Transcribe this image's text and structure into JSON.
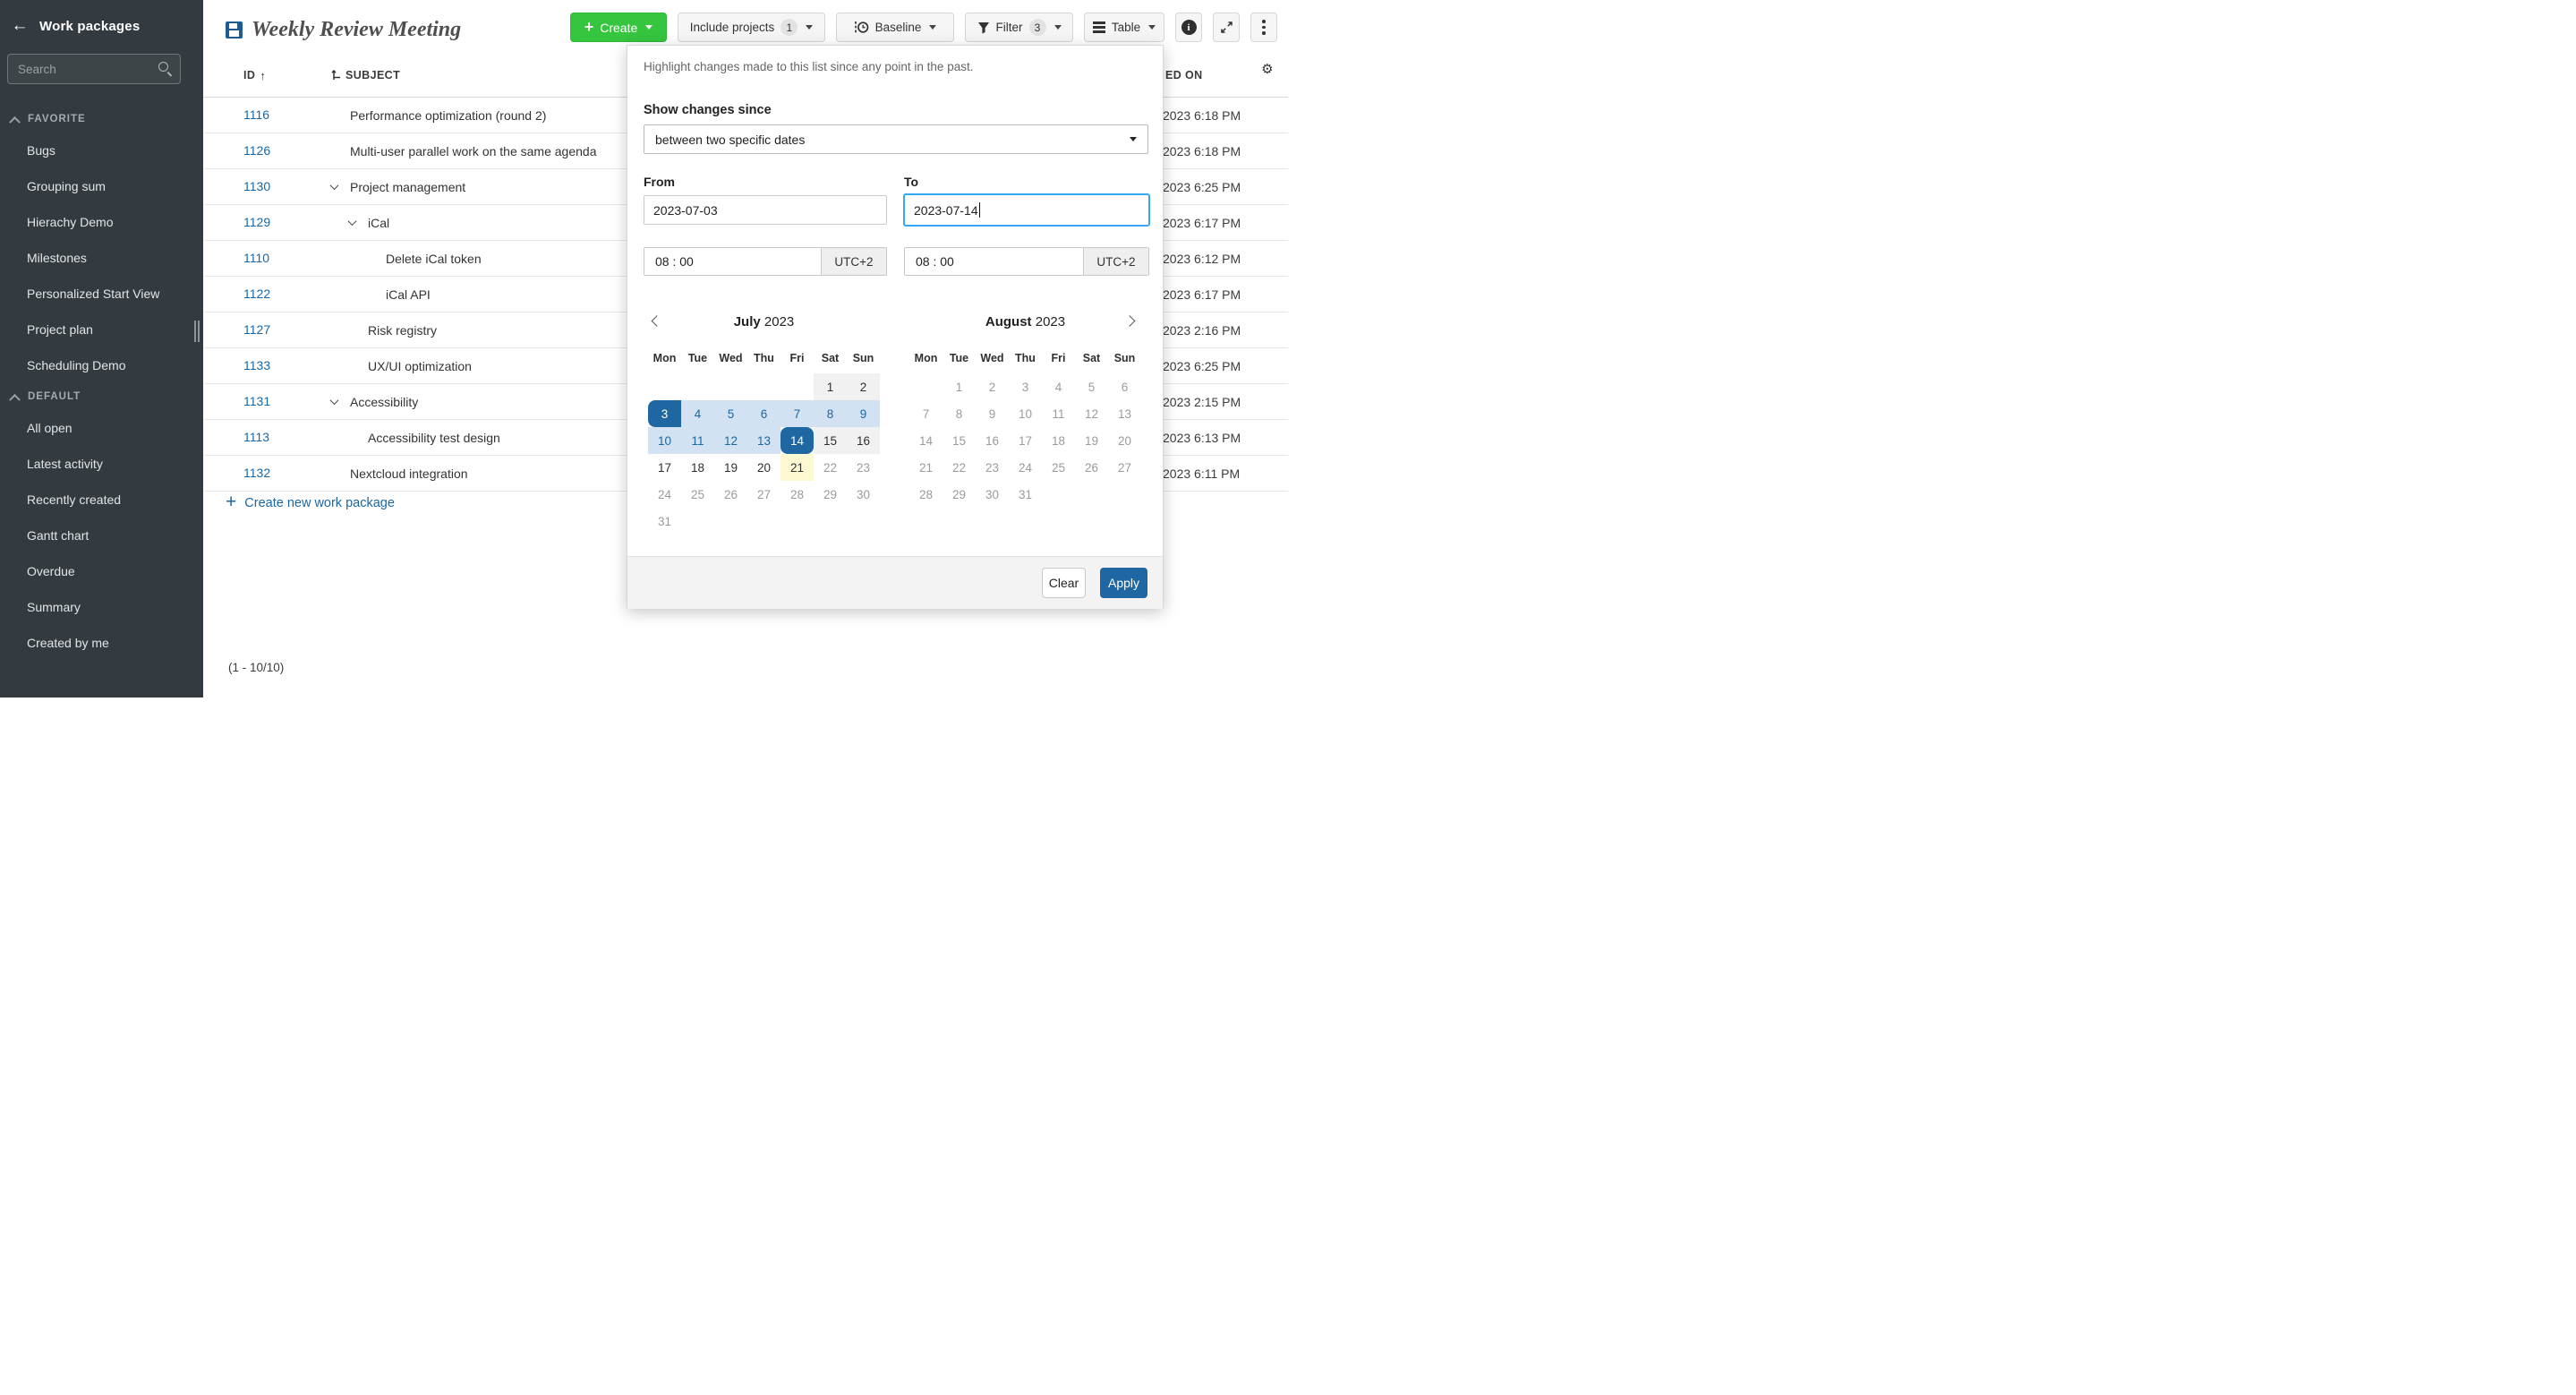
{
  "colors": {
    "accent_blue": "#1A67A3",
    "create_green": "#35C53F",
    "range_blue": "#D3E2F2",
    "today_yellow": "#FCF8D1",
    "focus_blue": "#35A6F0",
    "sidebar_bg": "#343B40"
  },
  "sidebar": {
    "title": "Work packages",
    "search_placeholder": "Search",
    "sections": [
      {
        "label": "FAVORITE",
        "items": [
          "Bugs",
          "Grouping sum",
          "Hierachy Demo",
          "Milestones",
          "Personalized Start View",
          "Project plan",
          "Scheduling Demo"
        ]
      },
      {
        "label": "DEFAULT",
        "items": [
          "All open",
          "Latest activity",
          "Recently created",
          "Gantt chart",
          "Overdue",
          "Summary",
          "Created by me"
        ]
      }
    ]
  },
  "header": {
    "title": "Weekly Review Meeting",
    "toolbar": {
      "create_label": "Create",
      "include_projects_label": "Include projects",
      "include_projects_count": "1",
      "baseline_label": "Baseline",
      "filter_label": "Filter",
      "filter_count": "3",
      "table_label": "Table"
    }
  },
  "table": {
    "columns": {
      "id": "ID",
      "subject": "SUBJECT",
      "updated": "ED ON"
    },
    "rows": [
      {
        "id": "1116",
        "subject": "Performance optimization (round 2)",
        "indent": 0,
        "chevron": false,
        "updated": "2023 6:18 PM"
      },
      {
        "id": "1126",
        "subject": "Multi-user parallel work on the same agenda",
        "indent": 0,
        "chevron": false,
        "updated": "2023 6:18 PM"
      },
      {
        "id": "1130",
        "subject": "Project management",
        "indent": 0,
        "chevron": true,
        "updated": "2023 6:25 PM"
      },
      {
        "id": "1129",
        "subject": "iCal",
        "indent": 1,
        "chevron": true,
        "updated": "2023 6:17 PM"
      },
      {
        "id": "1110",
        "subject": "Delete iCal token",
        "indent": 2,
        "chevron": false,
        "updated": "2023 6:12 PM"
      },
      {
        "id": "1122",
        "subject": "iCal API",
        "indent": 2,
        "chevron": false,
        "updated": "2023 6:17 PM"
      },
      {
        "id": "1127",
        "subject": "Risk registry",
        "indent": 1,
        "chevron": false,
        "updated": "2023 2:16 PM"
      },
      {
        "id": "1133",
        "subject": "UX/UI optimization",
        "indent": 1,
        "chevron": false,
        "updated": "2023 6:25 PM"
      },
      {
        "id": "1131",
        "subject": "Accessibility",
        "indent": 0,
        "chevron": true,
        "updated": "2023 2:15 PM"
      },
      {
        "id": "1113",
        "subject": "Accessibility test design",
        "indent": 1,
        "chevron": false,
        "updated": "2023 6:13 PM"
      },
      {
        "id": "1132",
        "subject": "Nextcloud integration",
        "indent": 0,
        "chevron": false,
        "updated": "2023 6:11 PM"
      }
    ],
    "create_link": "Create new work package",
    "pagination": "(1 - 10/10)"
  },
  "panel": {
    "description": "Highlight changes made to this list since any point in the past.",
    "show_changes_label": "Show changes since",
    "dropdown_value": "between two specific dates",
    "from_label": "From",
    "to_label": "To",
    "from_date": "2023-07-03",
    "to_date": "2023-07-14",
    "from_time": "08 : 00",
    "to_time": "08 : 00",
    "from_tz": "UTC+2",
    "to_tz": "UTC+2",
    "clear_label": "Clear",
    "apply_label": "Apply",
    "calendars": {
      "left": {
        "month": "July",
        "year": "2023",
        "weekdays": [
          "Mon",
          "Tue",
          "Wed",
          "Thu",
          "Fri",
          "Sat",
          "Sun"
        ],
        "rows": [
          [
            {
              "d": "",
              "s": "empty"
            },
            {
              "d": "",
              "s": "empty"
            },
            {
              "d": "",
              "s": "empty"
            },
            {
              "d": "",
              "s": "empty"
            },
            {
              "d": "",
              "s": "empty"
            },
            {
              "d": "1",
              "s": "wk"
            },
            {
              "d": "2",
              "s": "wk"
            }
          ],
          [
            {
              "d": "3",
              "s": "rs"
            },
            {
              "d": "4",
              "s": "rg"
            },
            {
              "d": "5",
              "s": "rg"
            },
            {
              "d": "6",
              "s": "rg"
            },
            {
              "d": "7",
              "s": "rg"
            },
            {
              "d": "8",
              "s": "rg"
            },
            {
              "d": "9",
              "s": "rg"
            }
          ],
          [
            {
              "d": "10",
              "s": "rg"
            },
            {
              "d": "11",
              "s": "rg"
            },
            {
              "d": "12",
              "s": "rg"
            },
            {
              "d": "13",
              "s": "rg"
            },
            {
              "d": "14",
              "s": "re"
            },
            {
              "d": "15",
              "s": "wk"
            },
            {
              "d": "16",
              "s": "wk"
            }
          ],
          [
            {
              "d": "17",
              "s": "nm"
            },
            {
              "d": "18",
              "s": "nm"
            },
            {
              "d": "19",
              "s": "nm"
            },
            {
              "d": "20",
              "s": "nm"
            },
            {
              "d": "21",
              "s": "td"
            },
            {
              "d": "22",
              "s": "ds"
            },
            {
              "d": "23",
              "s": "ds"
            }
          ],
          [
            {
              "d": "24",
              "s": "ds"
            },
            {
              "d": "25",
              "s": "ds"
            },
            {
              "d": "26",
              "s": "ds"
            },
            {
              "d": "27",
              "s": "ds"
            },
            {
              "d": "28",
              "s": "ds"
            },
            {
              "d": "29",
              "s": "ds"
            },
            {
              "d": "30",
              "s": "ds"
            }
          ],
          [
            {
              "d": "31",
              "s": "ds"
            },
            {
              "d": "",
              "s": "empty"
            },
            {
              "d": "",
              "s": "empty"
            },
            {
              "d": "",
              "s": "empty"
            },
            {
              "d": "",
              "s": "empty"
            },
            {
              "d": "",
              "s": "empty"
            },
            {
              "d": "",
              "s": "empty"
            }
          ]
        ]
      },
      "right": {
        "month": "August",
        "year": "2023",
        "weekdays": [
          "Mon",
          "Tue",
          "Wed",
          "Thu",
          "Fri",
          "Sat",
          "Sun"
        ],
        "rows": [
          [
            {
              "d": "",
              "s": "empty"
            },
            {
              "d": "1",
              "s": "ds"
            },
            {
              "d": "2",
              "s": "ds"
            },
            {
              "d": "3",
              "s": "ds"
            },
            {
              "d": "4",
              "s": "ds"
            },
            {
              "d": "5",
              "s": "ds"
            },
            {
              "d": "6",
              "s": "ds"
            }
          ],
          [
            {
              "d": "7",
              "s": "ds"
            },
            {
              "d": "8",
              "s": "ds"
            },
            {
              "d": "9",
              "s": "ds"
            },
            {
              "d": "10",
              "s": "ds"
            },
            {
              "d": "11",
              "s": "ds"
            },
            {
              "d": "12",
              "s": "ds"
            },
            {
              "d": "13",
              "s": "ds"
            }
          ],
          [
            {
              "d": "14",
              "s": "ds"
            },
            {
              "d": "15",
              "s": "ds"
            },
            {
              "d": "16",
              "s": "ds"
            },
            {
              "d": "17",
              "s": "ds"
            },
            {
              "d": "18",
              "s": "ds"
            },
            {
              "d": "19",
              "s": "ds"
            },
            {
              "d": "20",
              "s": "ds"
            }
          ],
          [
            {
              "d": "21",
              "s": "ds"
            },
            {
              "d": "22",
              "s": "ds"
            },
            {
              "d": "23",
              "s": "ds"
            },
            {
              "d": "24",
              "s": "ds"
            },
            {
              "d": "25",
              "s": "ds"
            },
            {
              "d": "26",
              "s": "ds"
            },
            {
              "d": "27",
              "s": "ds"
            }
          ],
          [
            {
              "d": "28",
              "s": "ds"
            },
            {
              "d": "29",
              "s": "ds"
            },
            {
              "d": "30",
              "s": "ds"
            },
            {
              "d": "31",
              "s": "ds"
            },
            {
              "d": "",
              "s": "empty"
            },
            {
              "d": "",
              "s": "empty"
            },
            {
              "d": "",
              "s": "empty"
            }
          ]
        ]
      }
    }
  }
}
